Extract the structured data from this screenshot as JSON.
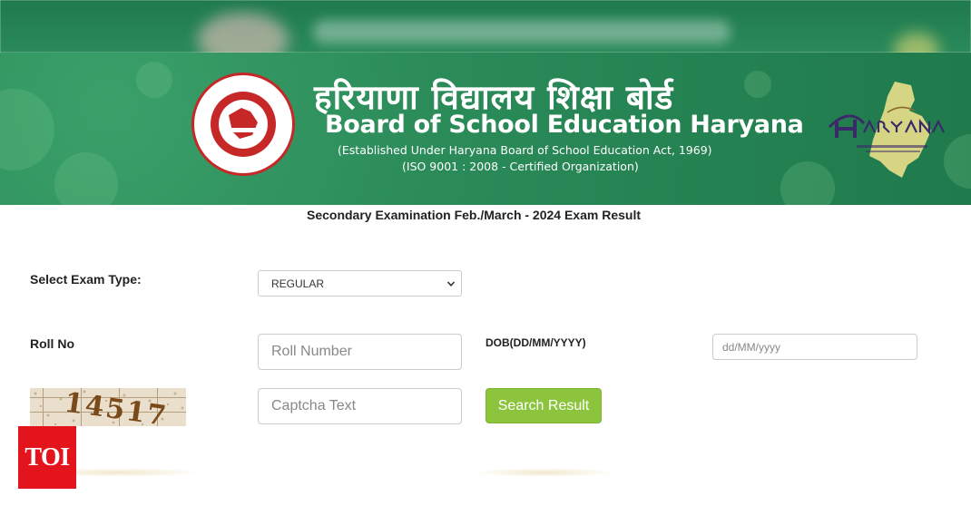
{
  "header": {
    "title_hindi": "हरियाणा विद्यालय शिक्षा बोर्ड",
    "title_english": "Board of School Education Haryana",
    "subtitle_established": "(Established Under Haryana Board of School Education Act, 1969)",
    "subtitle_iso": "(ISO 9001 : 2008 - Certified Organization)",
    "logo_icon": "bseh-emblem-icon",
    "right_logo_icon": "happening-haryana-logo-icon"
  },
  "form": {
    "heading": "Secondary Examination Feb./March - 2024 Exam Result",
    "exam_type_label": "Select Exam Type:",
    "exam_type_value": "REGULAR",
    "roll_no_label": "Roll No",
    "roll_no_placeholder": "Roll Number",
    "dob_label": "DOB(DD/MM/YYYY)",
    "dob_placeholder": "dd/MM/yyyy",
    "captcha_value": "14517",
    "captcha_placeholder": "Captcha Text",
    "search_button": "Search Result"
  },
  "watermark": {
    "text": "TOI"
  },
  "colors": {
    "banner_green": "#2a8a58",
    "logo_red": "#c62828",
    "button_green": "#8cc43e",
    "toi_red": "#e3141b"
  }
}
